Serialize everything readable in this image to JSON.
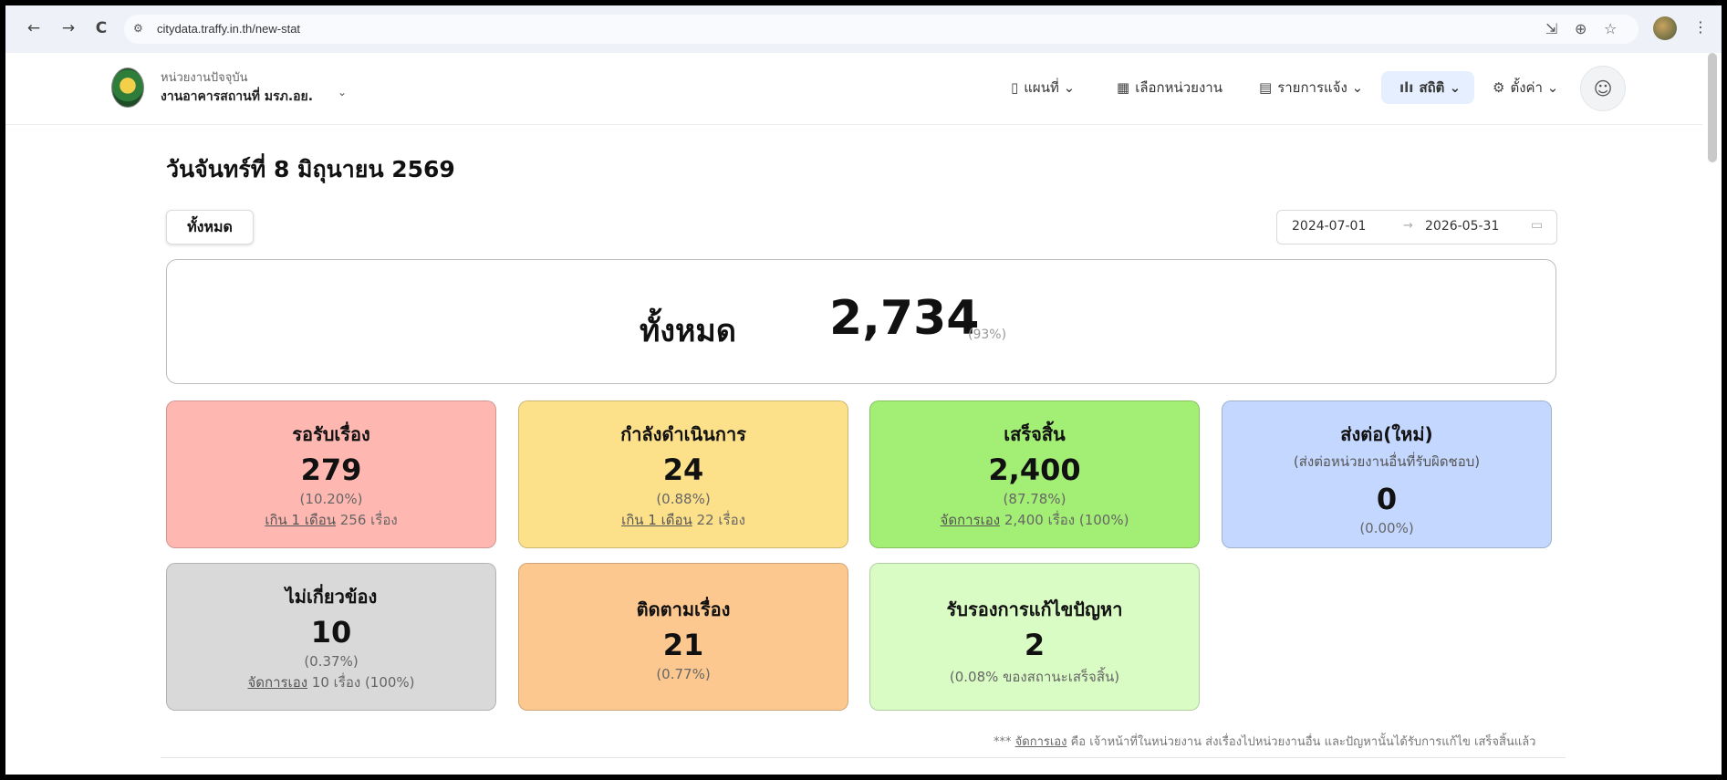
{
  "browser": {
    "url": "citydata.traffy.in.th/new-stat",
    "back_icon": "←",
    "forward_icon": "→",
    "reload_icon": "C"
  },
  "header": {
    "org_caption": "หน่วยงานปัจจุบัน",
    "org_name": "งานอาคารสถานที่ มรภ.อย.",
    "menu": [
      {
        "label": "แผนที่",
        "icon": "map-icon"
      },
      {
        "label": "เลือกหน่วยงาน",
        "icon": "grid-icon"
      },
      {
        "label": "รายการแจ้ง",
        "icon": "clipboard-icon"
      },
      {
        "label": "สถิติ",
        "icon": "chart-icon",
        "active": true
      },
      {
        "label": "ตั้งค่า",
        "icon": "gear-icon"
      }
    ]
  },
  "main": {
    "date_title": "วันจันทร์ที่ 8 มิถุนายน 2569",
    "filter_label": "ทั้งหมด",
    "date_start": "2024-07-01",
    "date_end": "2026-05-31",
    "total": {
      "label": "ทั้งหมด",
      "value": "2,734",
      "pct": "(93%)"
    },
    "cards": [
      {
        "title": "รอรับเรื่อง",
        "value": "279",
        "pct": "(10.20%)",
        "note_link": "เกิน 1 เดือน",
        "note_text": " 256 เรื่อง",
        "color": "#ffb8b1"
      },
      {
        "title": "กำลังดำเนินการ",
        "value": "24",
        "pct": "(0.88%)",
        "note_link": "เกิน 1 เดือน",
        "note_text": " 22 เรื่อง",
        "color": "#fde08a"
      },
      {
        "title": "เสร็จสิ้น",
        "value": "2,400",
        "pct": "(87.78%)",
        "note_link": "จัดการเอง",
        "note_text": " 2,400 เรื่อง (100%)",
        "color": "#a3ee75"
      },
      {
        "title": "ส่งต่อ(ใหม่)",
        "subtitle": "(ส่งต่อหน่วยงานอื่นที่รับผิดชอบ)",
        "value": "0",
        "pct": "(0.00%)",
        "color": "#c4d7ff"
      },
      {
        "title": "ไม่เกี่ยวข้อง",
        "value": "10",
        "pct": "(0.37%)",
        "note_link": "จัดการเอง",
        "note_text": " 10 เรื่อง (100%)",
        "color": "#d9d9d9"
      },
      {
        "title": "ติดตามเรื่อง",
        "value": "21",
        "pct": "(0.77%)",
        "color": "#fdc890"
      },
      {
        "title": "รับรองการแก้ไขปัญหา",
        "value": "2",
        "pct": "(0.08% ของสถานะเสร็จสิ้น)",
        "color": "#d9fcc4"
      }
    ],
    "footnote_prefix": "*** ",
    "footnote_link": "จัดการเอง",
    "footnote_text": " คือ เจ้าหน้าที่ในหน่วยงาน ส่งเรื่องไปหน่วยงานอื่น และปัญหานั้นได้รับการแก้ไข เสร็จสิ้นแล้ว"
  }
}
